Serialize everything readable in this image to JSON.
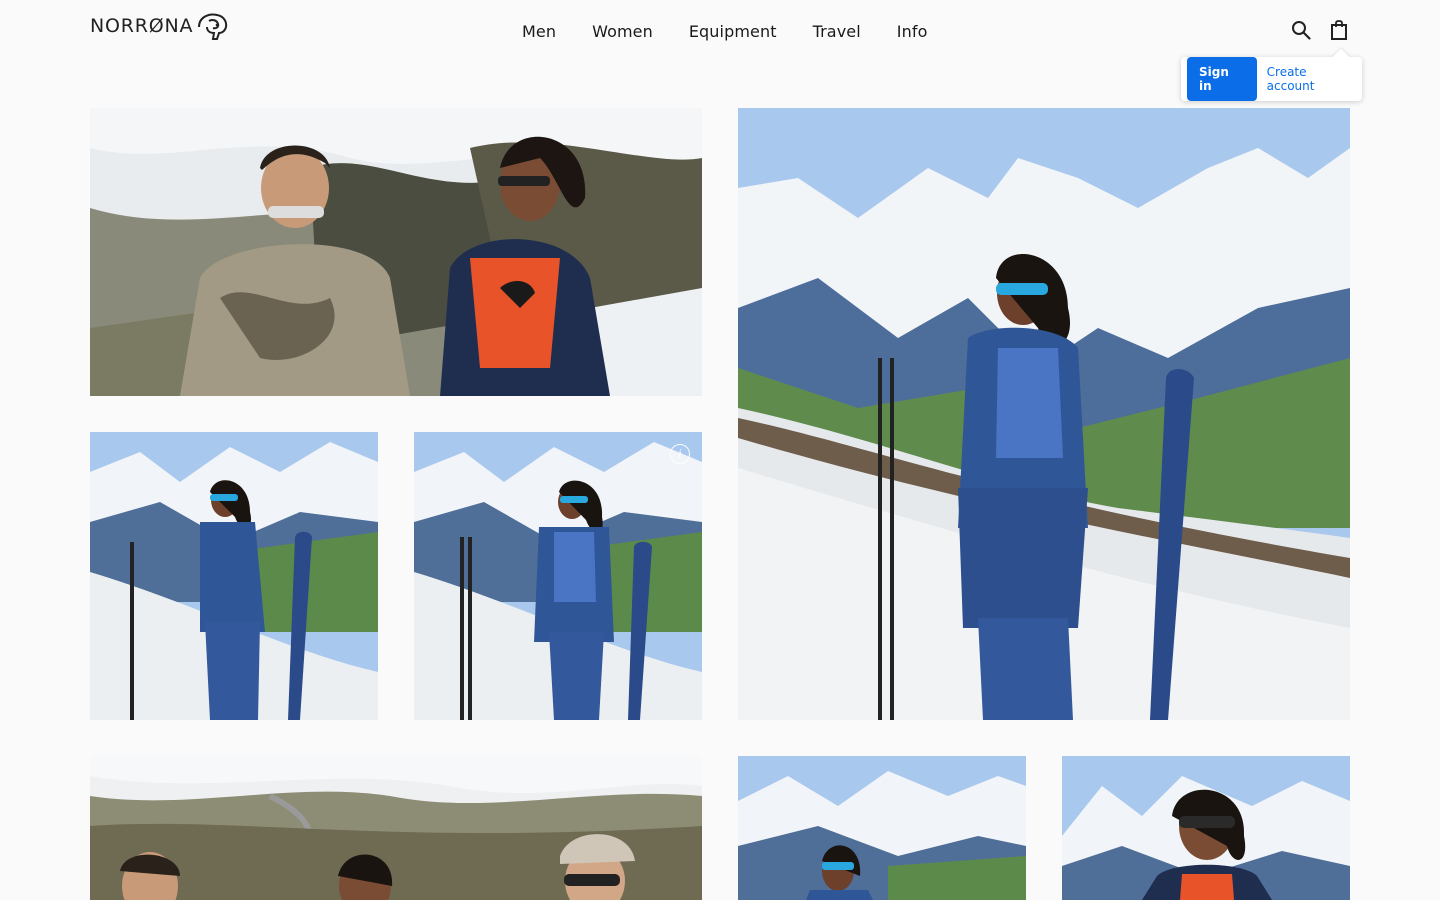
{
  "brand": {
    "name": "NORRØNA"
  },
  "nav": {
    "items": [
      {
        "label": "Men"
      },
      {
        "label": "Women"
      },
      {
        "label": "Equipment"
      },
      {
        "label": "Travel"
      },
      {
        "label": "Info"
      }
    ]
  },
  "header_icons": {
    "search": "search-icon",
    "cart": "shopping-bag-icon"
  },
  "account_popover": {
    "signin_label": "Sign in",
    "create_label": "Create account"
  },
  "colors": {
    "accent": "#0b6ee8",
    "background": "#fafafa"
  },
  "gallery": {
    "photos": [
      {
        "alt": "Man in camo shirt and woman in orange tee with navy vest sitting among snowy rocks"
      },
      {
        "alt": "Woman in blue outfit with ski and poles on snowy mountain slope"
      },
      {
        "alt": "Woman in blue jacket and skirt holding ski pole on snowy slope"
      },
      {
        "alt": "Woman in blue jacket and skirt standing next to ski on snowy slope"
      },
      {
        "alt": "Group of hikers in front of snowy valley road"
      },
      {
        "alt": "Woman in blue with sunglasses on mountain"
      },
      {
        "alt": "Woman in orange and navy vest with sunglasses"
      }
    ],
    "info_icon": "info-icon"
  }
}
